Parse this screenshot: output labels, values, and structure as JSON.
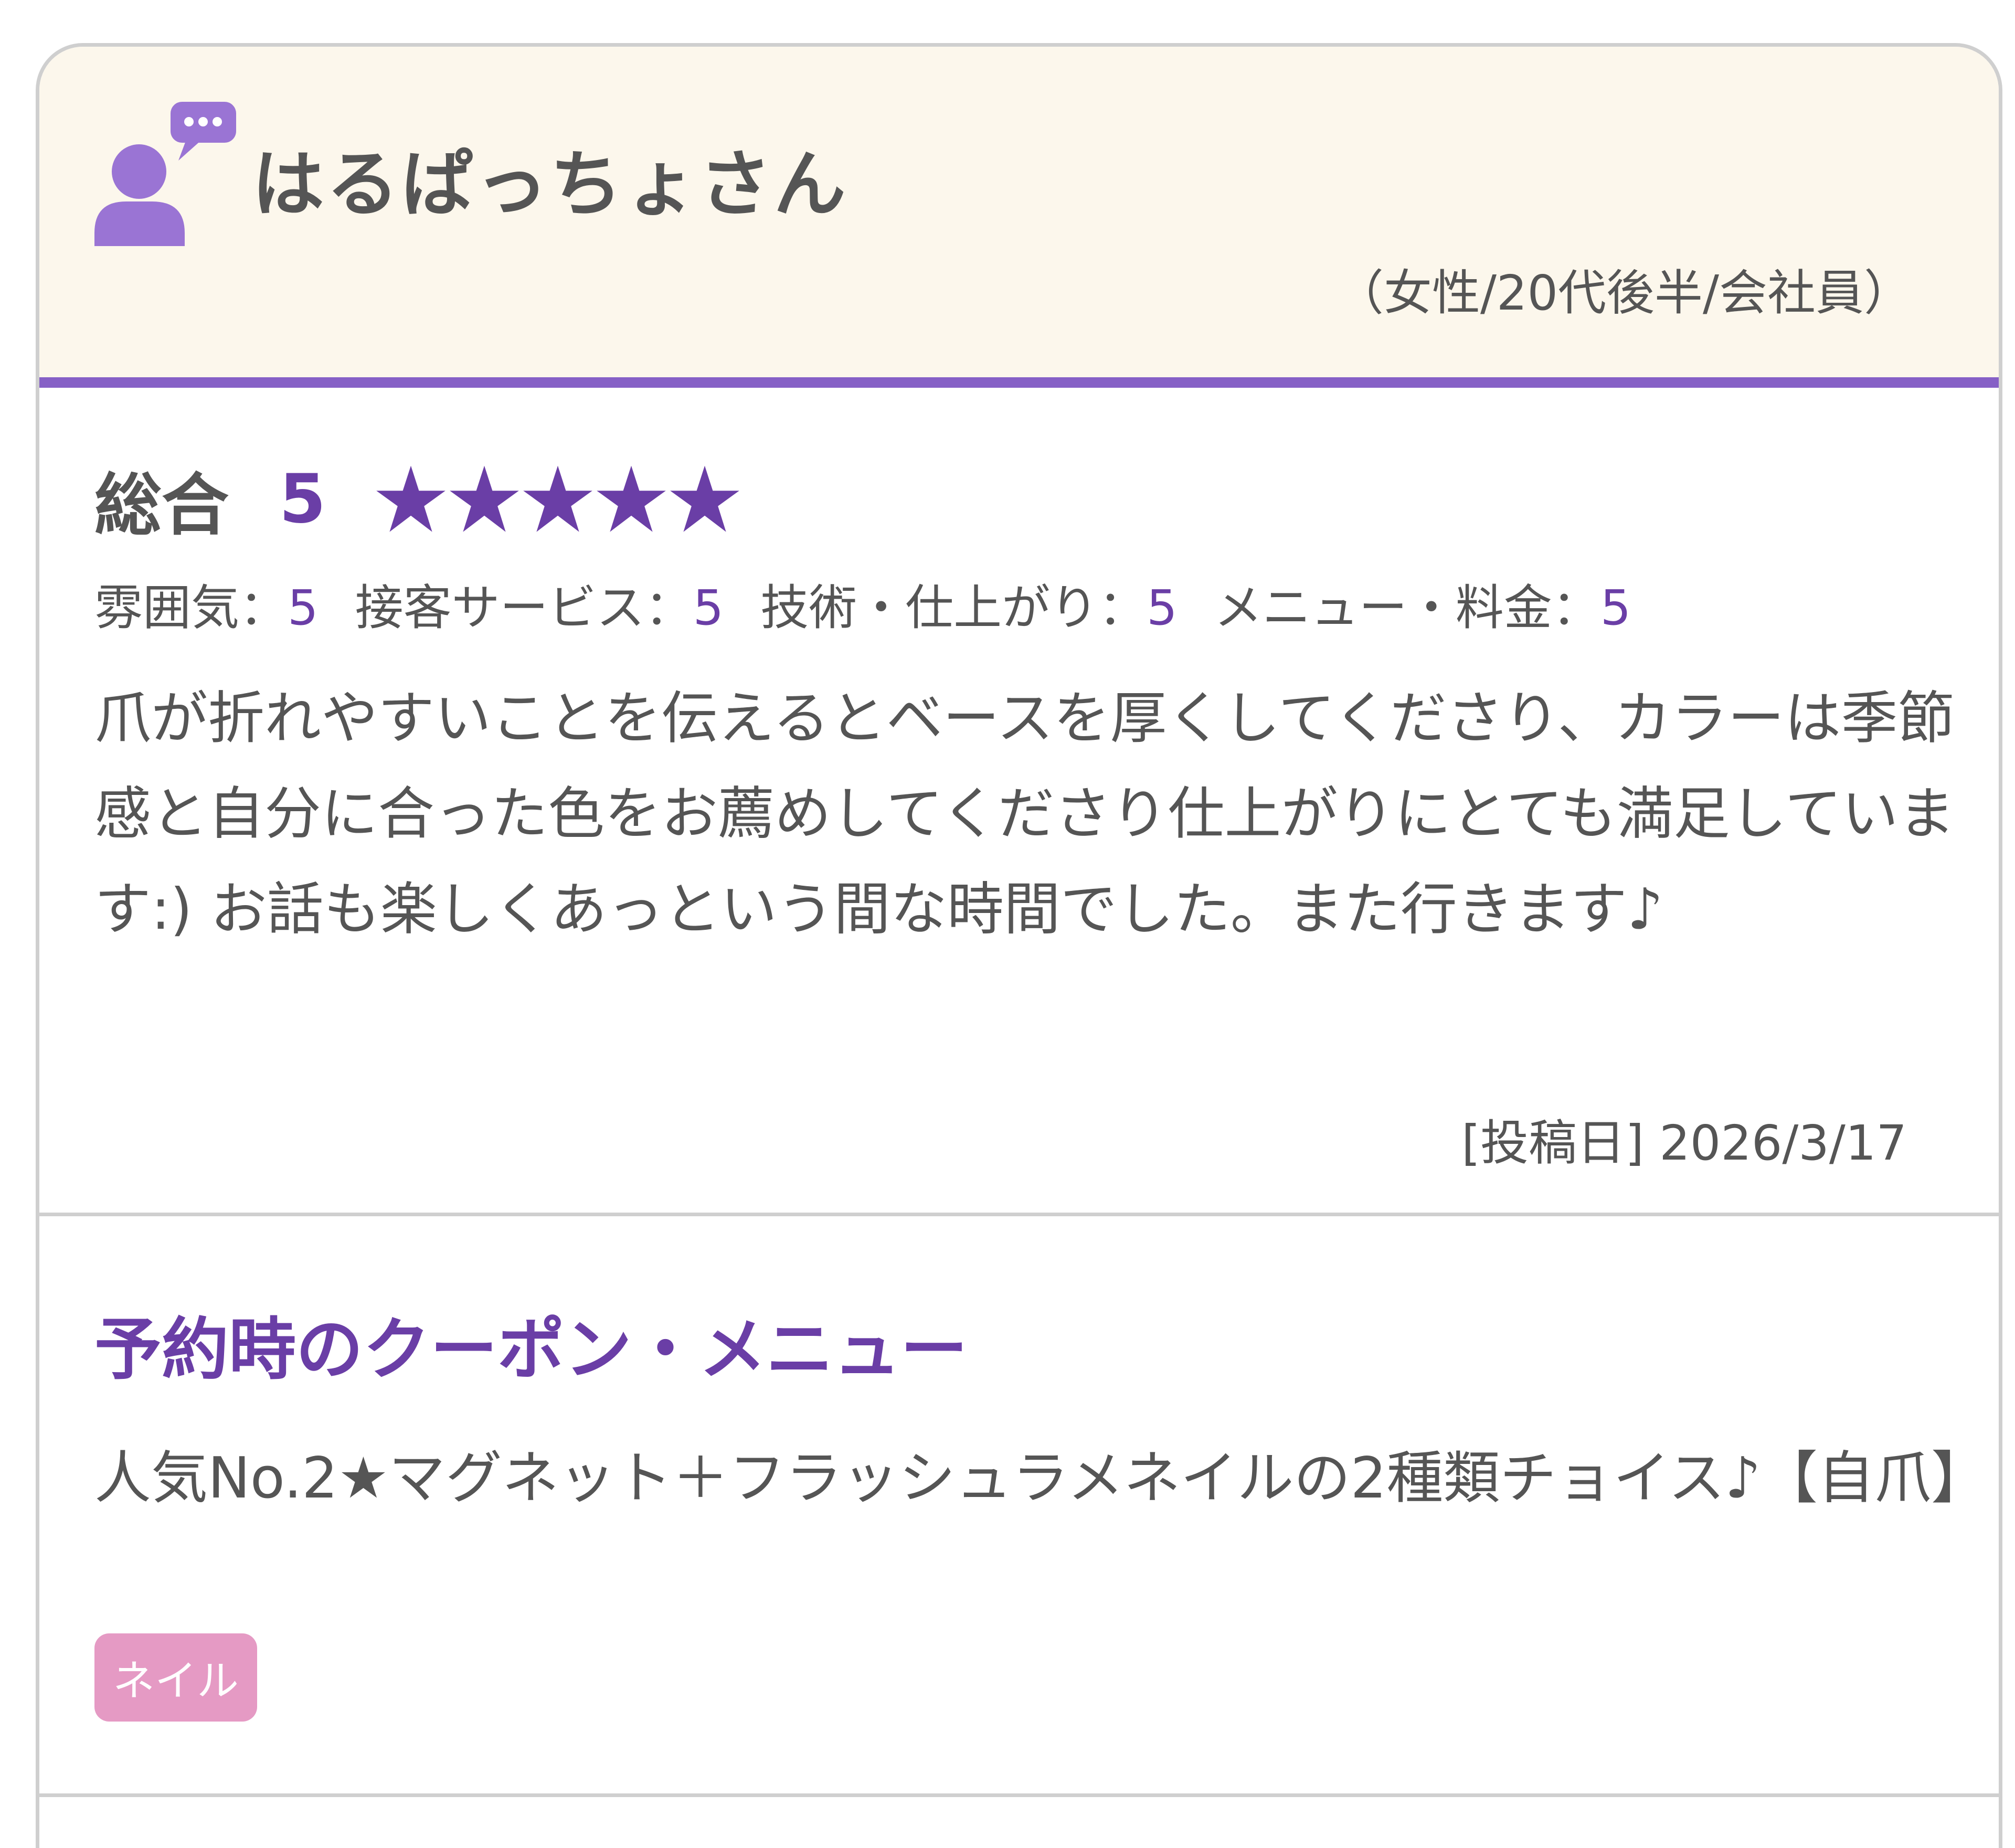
{
  "reviewer": {
    "name": "はるぱっちょさん",
    "demographic": "（女性/20代後半/会社員）"
  },
  "rating": {
    "overall_label": "総合",
    "overall_score": "5",
    "stars": 5,
    "sub_ratings": [
      {
        "label": "雰囲気：",
        "score": "5"
      },
      {
        "label": "接客サービス：",
        "score": "5"
      },
      {
        "label": "技術・仕上がり：",
        "score": "5"
      },
      {
        "label": "メニュー・料金：",
        "score": "5"
      }
    ]
  },
  "comment": "爪が折れやすいことを伝えるとベースを厚くしてくださり、カラーは季節感と自分に合った色をお薦めしてくださり仕上がりにとても満足しています:) お話も楽しくあっという間な時間でした。また行きます♪",
  "post_date": "[投稿日] 2026/3/17",
  "menu": {
    "title": "予約時のクーポン・メニュー",
    "coupon": "人気No.2★マグネット＋フラッシュラメネイルの2種類チョイス♪【自爪】",
    "tag": "ネイル"
  },
  "colors": {
    "accent": "#6a3ea6",
    "header_bg": "#fcf7ec",
    "header_border": "#8660c6",
    "tag_bg": "#e59ac4",
    "text": "#555555"
  }
}
